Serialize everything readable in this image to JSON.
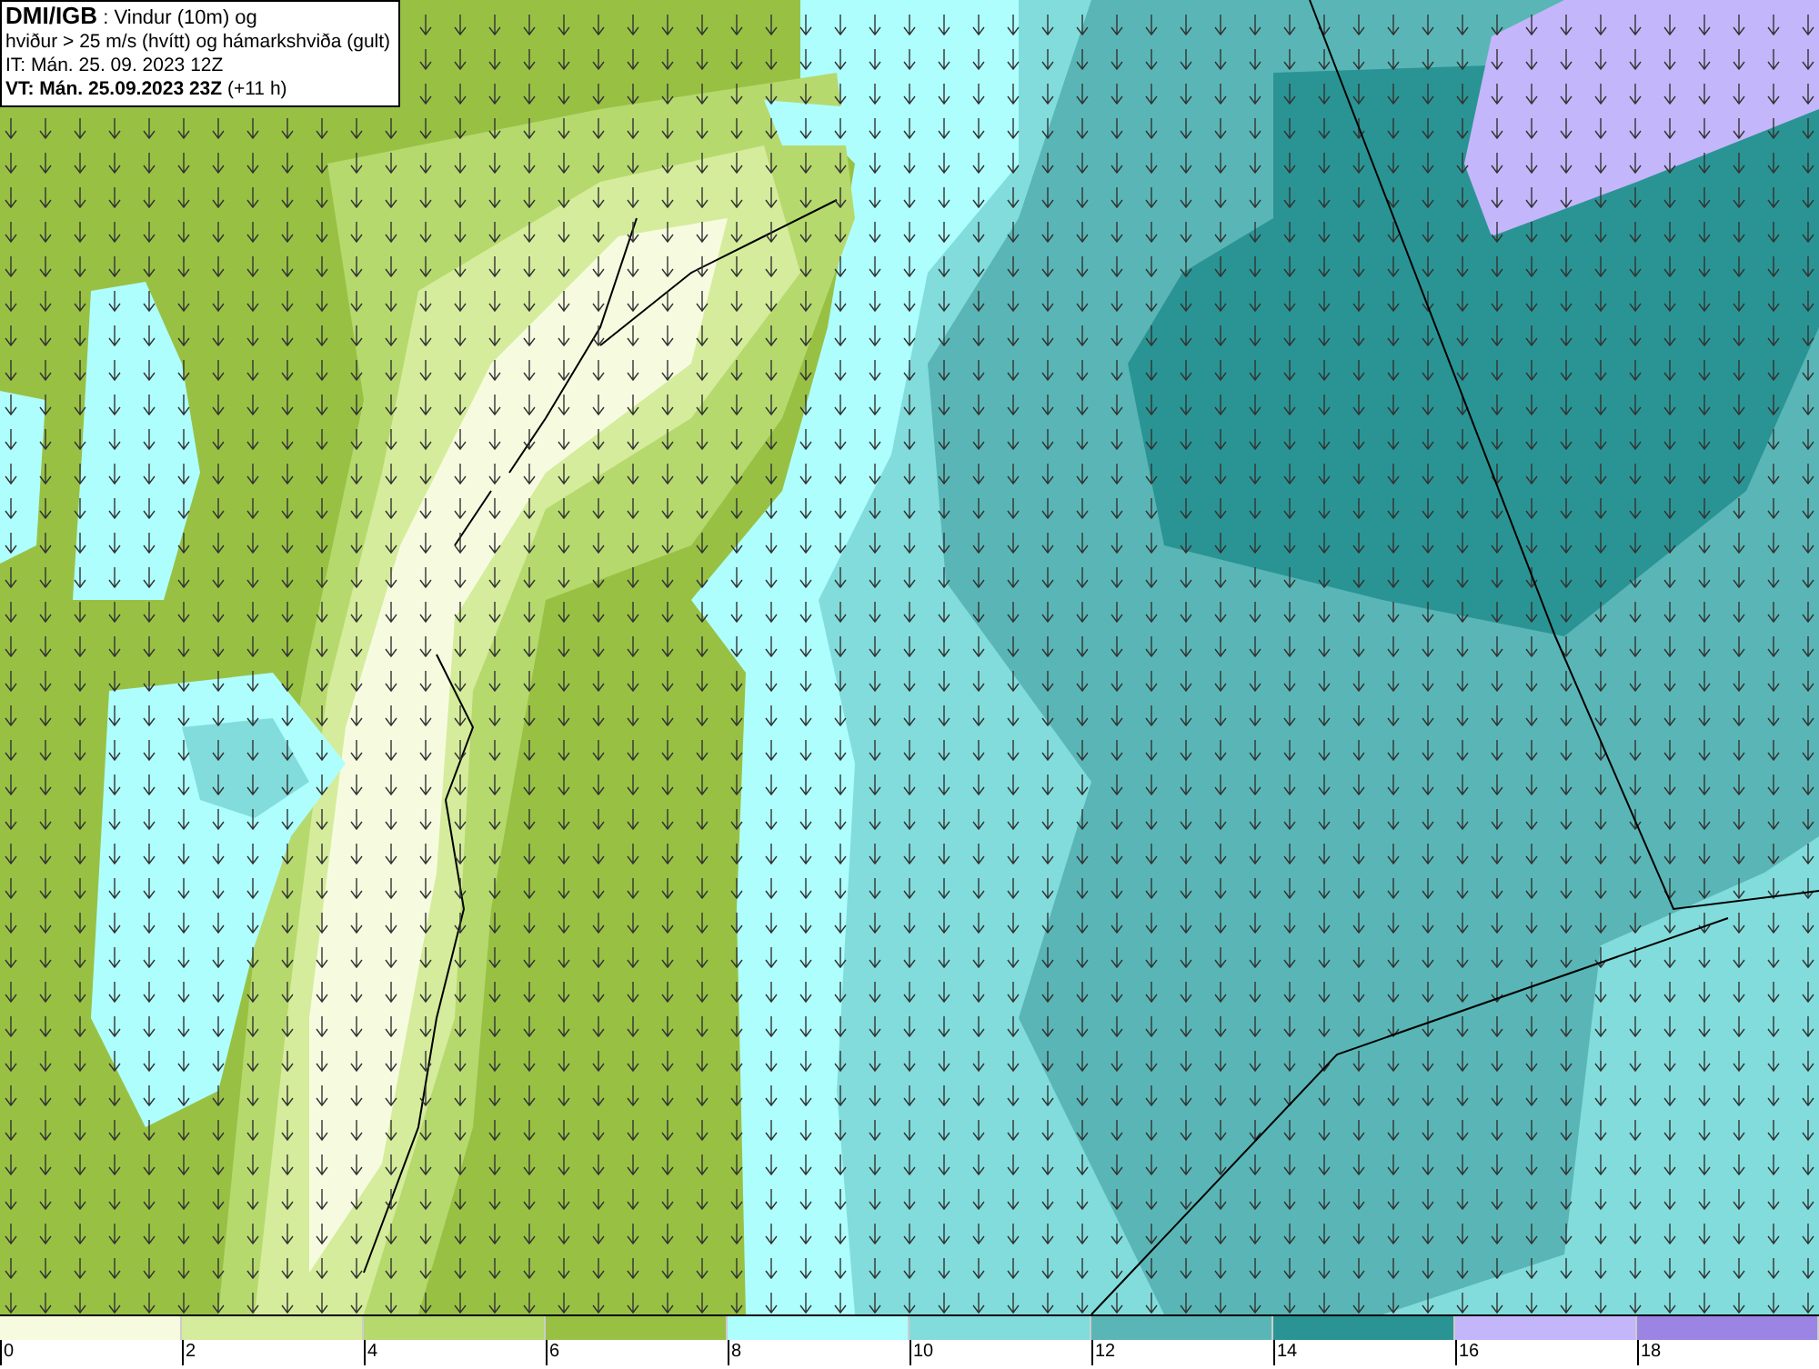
{
  "title_box": {
    "lines": [
      "**DMI/IGB** : Vindur (10m) og",
      "hviður > 25 m/s (hvítt) og hámarkshviða (gult)",
      "IT: Mán. 25. 09. 2023 12Z",
      "**VT: Mán. 25.09.2023 23Z** (+11 h)"
    ]
  },
  "legend": [
    {
      "label": "0",
      "color": "#f6fbe0"
    },
    {
      "label": "2",
      "color": "#d5ec9c"
    },
    {
      "label": "4",
      "color": "#b6d96e"
    },
    {
      "label": "6",
      "color": "#98c144"
    },
    {
      "label": "8",
      "color": "#aefefe"
    },
    {
      "label": "10",
      "color": "#82dcdc"
    },
    {
      "label": "12",
      "color": "#5ab6b6"
    },
    {
      "label": "14",
      "color": "#2a9494"
    },
    {
      "label": "16",
      "color": "#c4b6fa"
    },
    {
      "label": "18",
      "color": "#9c84e4"
    }
  ]
}
